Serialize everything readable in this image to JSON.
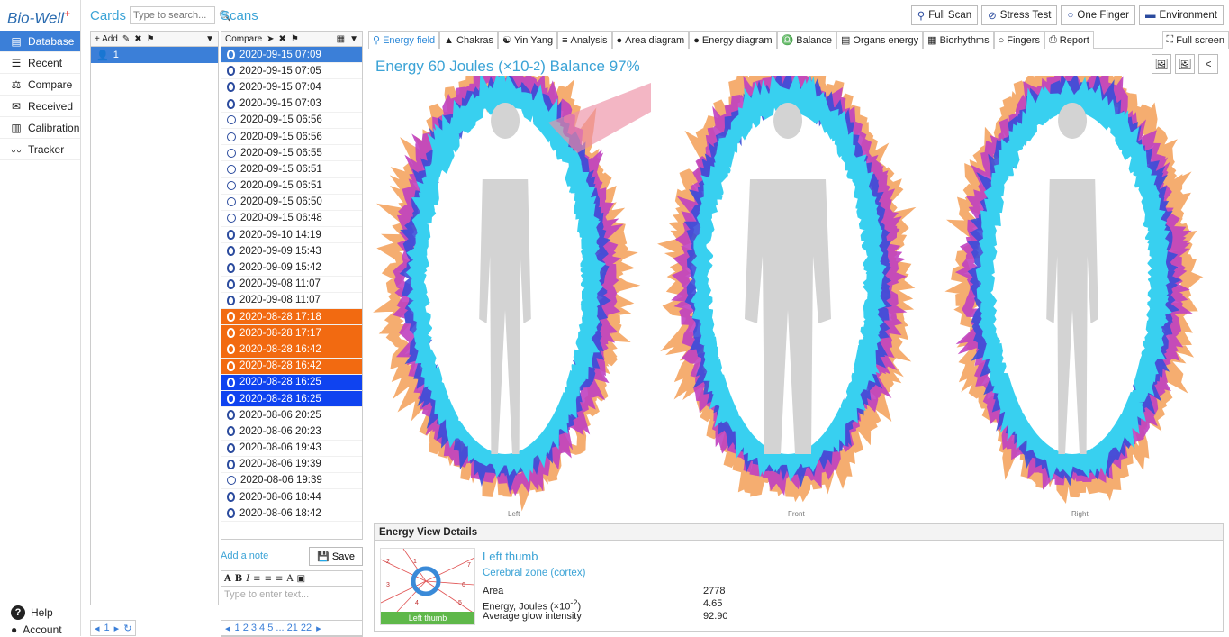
{
  "app": {
    "logo": "Bio-Well",
    "logo_mark": "+"
  },
  "nav": {
    "items": [
      {
        "label": "Database",
        "icon": "database-icon"
      },
      {
        "label": "Recent",
        "icon": "list-icon"
      },
      {
        "label": "Compare",
        "icon": "scales-icon"
      },
      {
        "label": "Received",
        "icon": "inbox-icon"
      },
      {
        "label": "Calibration",
        "icon": "calibration-icon"
      },
      {
        "label": "Tracker",
        "icon": "pulse-icon"
      }
    ],
    "help": "Help",
    "account": "Account"
  },
  "cards": {
    "title": "Cards",
    "search_placeholder": "Type to search...",
    "toolbar_add": "+ Add",
    "rows": [
      {
        "label": "1",
        "count": "1"
      }
    ],
    "pager": "1"
  },
  "scans": {
    "title": "Scans",
    "toolbar_compare": "Compare",
    "rows": [
      {
        "t": "2020-09-15 07:09",
        "type": "finger",
        "state": "sel"
      },
      {
        "t": "2020-09-15 07:05",
        "type": "finger",
        "state": ""
      },
      {
        "t": "2020-09-15 07:04",
        "type": "finger",
        "state": ""
      },
      {
        "t": "2020-09-15 07:03",
        "type": "finger",
        "state": ""
      },
      {
        "t": "2020-09-15 06:56",
        "type": "stress",
        "state": ""
      },
      {
        "t": "2020-09-15 06:56",
        "type": "stress",
        "state": ""
      },
      {
        "t": "2020-09-15 06:55",
        "type": "stress",
        "state": ""
      },
      {
        "t": "2020-09-15 06:51",
        "type": "stress",
        "state": ""
      },
      {
        "t": "2020-09-15 06:51",
        "type": "stress",
        "state": ""
      },
      {
        "t": "2020-09-15 06:50",
        "type": "stress",
        "state": ""
      },
      {
        "t": "2020-09-15 06:48",
        "type": "stress",
        "state": ""
      },
      {
        "t": "2020-09-10 14:19",
        "type": "finger",
        "state": ""
      },
      {
        "t": "2020-09-09 15:43",
        "type": "finger",
        "state": ""
      },
      {
        "t": "2020-09-09 15:42",
        "type": "finger",
        "state": ""
      },
      {
        "t": "2020-09-08 11:07",
        "type": "finger",
        "state": ""
      },
      {
        "t": "2020-09-08 11:07",
        "type": "finger",
        "state": ""
      },
      {
        "t": "2020-08-28 17:18",
        "type": "finger",
        "state": "orange"
      },
      {
        "t": "2020-08-28 17:17",
        "type": "finger",
        "state": "orange"
      },
      {
        "t": "2020-08-28 16:42",
        "type": "finger",
        "state": "orange"
      },
      {
        "t": "2020-08-28 16:42",
        "type": "finger",
        "state": "orange"
      },
      {
        "t": "2020-08-28 16:25",
        "type": "finger",
        "state": "blue"
      },
      {
        "t": "2020-08-28 16:25",
        "type": "finger",
        "state": "blue"
      },
      {
        "t": "2020-08-06 20:25",
        "type": "finger",
        "state": ""
      },
      {
        "t": "2020-08-06 20:23",
        "type": "finger",
        "state": ""
      },
      {
        "t": "2020-08-06 19:43",
        "type": "finger",
        "state": ""
      },
      {
        "t": "2020-08-06 19:39",
        "type": "finger",
        "state": ""
      },
      {
        "t": "2020-08-06 19:39",
        "type": "stress",
        "state": ""
      },
      {
        "t": "2020-08-06 18:44",
        "type": "finger",
        "state": ""
      },
      {
        "t": "2020-08-06 18:42",
        "type": "finger",
        "state": ""
      }
    ],
    "add_note": "Add a note",
    "save": "Save",
    "note_placeholder": "Type to enter text...",
    "pager": "1 2 3 4 5 ... 21 22"
  },
  "actions": [
    "Full Scan",
    "Stress Test",
    "One Finger",
    "Environment"
  ],
  "tabs": [
    "Energy field",
    "Chakras",
    "Yin Yang",
    "Analysis",
    "Area diagram",
    "Energy diagram",
    "Balance",
    "Organs energy",
    "Biorhythms",
    "Fingers",
    "Report",
    "Full screen"
  ],
  "energy": {
    "title": "Energy 60 Joules (×10",
    "sup": "-2",
    "title_rest": ") Balance 97%"
  },
  "views": [
    "Left",
    "Front",
    "Right"
  ],
  "details": {
    "header": "Energy View Details",
    "finger": "Left thumb",
    "zone": "Cerebral zone (cortex)",
    "thumb_caption": "Left thumb",
    "sector_numbers": [
      "1",
      "2",
      "3",
      "4",
      "5",
      "6",
      "7"
    ],
    "rows": [
      {
        "k": "Area",
        "v": "2778"
      },
      {
        "k": "Energy, Joules (×10",
        "k_sup": "-2",
        "k_rest": ")",
        "v": "4.65"
      },
      {
        "k": "Average glow intensity",
        "v": "92.90"
      }
    ]
  }
}
